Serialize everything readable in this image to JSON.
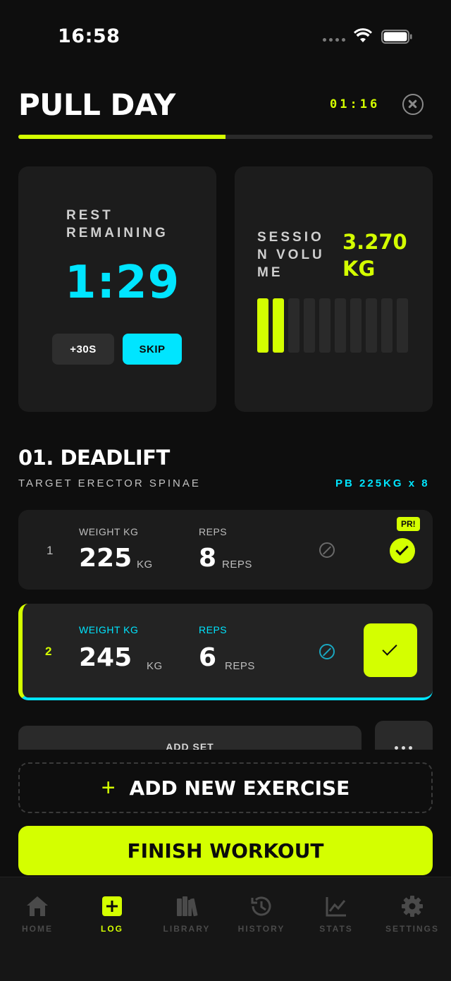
{
  "status": {
    "time": "16:58"
  },
  "header": {
    "title": "PULL DAY",
    "elapsed": "01:16"
  },
  "workout_progress": 0.5,
  "rest": {
    "label": "REST REMAINING",
    "time": "1:29",
    "add_button": "+30S",
    "skip_button": "SKIP"
  },
  "session": {
    "label": "SESSION VOLUME",
    "value": "3.270 KG",
    "bars_total": 10,
    "bars_filled": 2
  },
  "exercise": {
    "name": "01. DEADLIFT",
    "target": "TARGET ERECTOR SPINAE",
    "pb": "PB 225KG x 8"
  },
  "sets": [
    {
      "num": "1",
      "weight_label": "WEIGHT KG",
      "weight": "225",
      "weight_unit": "KG",
      "reps_label": "REPS",
      "reps": "8",
      "reps_unit": "REPS",
      "badge": "PR!",
      "completed": true
    },
    {
      "num": "2",
      "weight_label": "WEIGHT KG",
      "weight": "245",
      "weight_unit": "KG",
      "reps_label": "REPS",
      "reps": "6",
      "reps_unit": "REPS",
      "active": true
    }
  ],
  "actions": {
    "add_set": "ADD SET",
    "add_exercise": "ADD NEW EXERCISE",
    "finish": "FINISH WORKOUT"
  },
  "tabs": [
    {
      "label": "HOME",
      "icon": "home-icon"
    },
    {
      "label": "LOG",
      "icon": "plus-square-icon",
      "active": true
    },
    {
      "label": "LIBRARY",
      "icon": "books-icon"
    },
    {
      "label": "HISTORY",
      "icon": "history-icon"
    },
    {
      "label": "STATS",
      "icon": "chart-icon"
    },
    {
      "label": "SETTINGS",
      "icon": "gear-icon"
    }
  ],
  "colors": {
    "accent": "#d4ff00",
    "cyan": "#00e5ff",
    "background": "#0e0e0e",
    "card": "#1c1c1c"
  }
}
